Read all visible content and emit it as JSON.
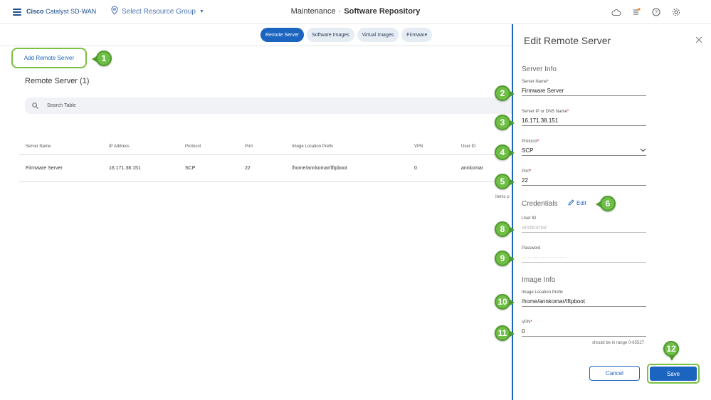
{
  "header": {
    "brand_bold": "Cisco",
    "brand_rest": "Catalyst SD-WAN",
    "resource_group": "Select Resource Group",
    "title_section": "Maintenance",
    "title_separator": "·",
    "title_page": "Software Repository",
    "icons": [
      "cloud-icon",
      "task-list-icon",
      "help-icon",
      "settings-icon"
    ]
  },
  "tabs": [
    {
      "label": "Remote Server",
      "active": true
    },
    {
      "label": "Software Images",
      "active": false
    },
    {
      "label": "Virtual Images",
      "active": false
    },
    {
      "label": "Firmware",
      "active": false
    }
  ],
  "main": {
    "add_button": "Add Remote Server",
    "section_title": "Remote Server (1)",
    "search_placeholder": "Search Table",
    "columns": [
      "Server Name",
      "IP Address",
      "Protocol",
      "Port",
      "Image Location Prefix",
      "VPN",
      "User ID"
    ],
    "rows": [
      [
        "Firmware Server",
        "16.171.38.151",
        "SCP",
        "22",
        "/home/annkomar/tftpboot",
        "0",
        "annkomar"
      ]
    ],
    "items_per_page_label": "Items p"
  },
  "drawer": {
    "title": "Edit Remote Server",
    "server_info_heading": "Server Info",
    "server_name_label": "Server Name",
    "server_name_value": "Firmware Server",
    "server_ip_label": "Server IP or DNS Name",
    "server_ip_value": "16.171.38.151",
    "protocol_label": "Protocol",
    "protocol_value": "SCP",
    "port_label": "Port",
    "port_value": "22",
    "credentials_heading": "Credentials",
    "edit_link": "Edit",
    "user_id_label": "User ID",
    "user_id_value": "annkomar",
    "password_label": "Password",
    "password_value": "························",
    "image_info_heading": "Image Info",
    "image_prefix_label": "Image Location Prefix",
    "image_prefix_value": "/home/annkomar/tftpboot",
    "vpn_label": "VPN",
    "vpn_value": "0",
    "vpn_hint": "should be in range 0-65527",
    "required_marker": "*",
    "cancel_button": "Cancel",
    "save_button": "Save"
  },
  "callouts": [
    "1",
    "2",
    "3",
    "4",
    "5",
    "6",
    "8",
    "9",
    "10",
    "11",
    "12"
  ],
  "colors": {
    "accent": "#1b64c0",
    "callout_green": "#6fbe46",
    "highlight_border": "#7ac142"
  }
}
